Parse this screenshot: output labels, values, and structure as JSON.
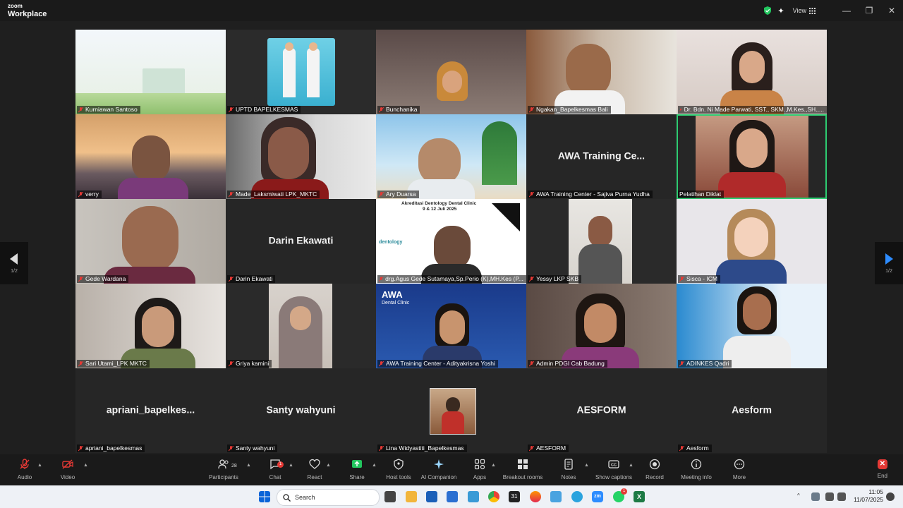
{
  "app": {
    "logo_line1": "zoom",
    "logo_line2": "Workplace",
    "view_label": "View"
  },
  "window_controls": {
    "minimize": "—",
    "restore": "❐",
    "close": "✕"
  },
  "pager": {
    "left": "1/2",
    "right": "1/2"
  },
  "participants": [
    {
      "name": "Kurniawan Santoso"
    },
    {
      "name": "UPTD BAPELKESMAS"
    },
    {
      "name": "Bunchanika"
    },
    {
      "name": "Ngakan_Bapelkesmas Bali"
    },
    {
      "name": "Dr. Bdn. Ni Made Parwati, SST., SKM.,M.Kes.,SH.,..."
    },
    {
      "name": "verry"
    },
    {
      "name": "Made_Laksmiwati LPK_MKTC"
    },
    {
      "name": "Ary Duarsa"
    },
    {
      "name": "AWA Training Center - Sajiva Purna Yudha",
      "display": "AWA Training Ce..."
    },
    {
      "name": "Pelatihan Diklat"
    },
    {
      "name": "Gede Wardana"
    },
    {
      "name": "Darin Ekawati",
      "display": "Darin Ekawati"
    },
    {
      "name": "drg.Agus Gede Sutamaya,Sp.Perio (K),MH.Kes (P..."
    },
    {
      "name": "Yessy LKP SKB"
    },
    {
      "name": "Sisca - ICM"
    },
    {
      "name": "Sari Utami_LPK MKTC"
    },
    {
      "name": "Griya kamini"
    },
    {
      "name": "AWA Training Center - Adityakrisna Yoshi"
    },
    {
      "name": "Admin PDGI Cab Badung"
    },
    {
      "name": "ADINKES Qadri"
    },
    {
      "name": "apriani_bapelkesmas",
      "display": "apriani_bapelkes..."
    },
    {
      "name": "Santy wahyuni",
      "display": "Santy wahyuni"
    },
    {
      "name": "Lina Widyastiti_Bapelkesmas"
    },
    {
      "name": "AESFORM",
      "display": "AESFORM"
    },
    {
      "name": "Aesform",
      "display": "Aesform"
    }
  ],
  "slide": {
    "title": "Akreditasi Dentology Dental Clinic",
    "date": "9 & 12 Juli 2025",
    "brand": "dentology"
  },
  "awa_bg": {
    "brand": "AWA",
    "sub": "Dental Clinic"
  },
  "toolbar": {
    "audio": "Audio",
    "video": "Video",
    "participants": "Participants",
    "participants_count": "28",
    "chat": "Chat",
    "chat_badge": "1",
    "react": "React",
    "share": "Share",
    "host_tools": "Host tools",
    "ai_companion": "AI Companion",
    "apps": "Apps",
    "breakout": "Breakout rooms",
    "notes": "Notes",
    "captions": "Show captions",
    "record": "Record",
    "meeting_info": "Meeting info",
    "more": "More",
    "end": "End"
  },
  "taskbar": {
    "search": "Search",
    "time": "11:05",
    "date": "11/07/2025",
    "calendar_day": "31",
    "whatsapp_badge": "1"
  },
  "colors": {
    "accent_green": "#2ecc71",
    "end_red": "#e53935",
    "share_green": "#22c55e",
    "nav_blue": "#2d8cff"
  }
}
